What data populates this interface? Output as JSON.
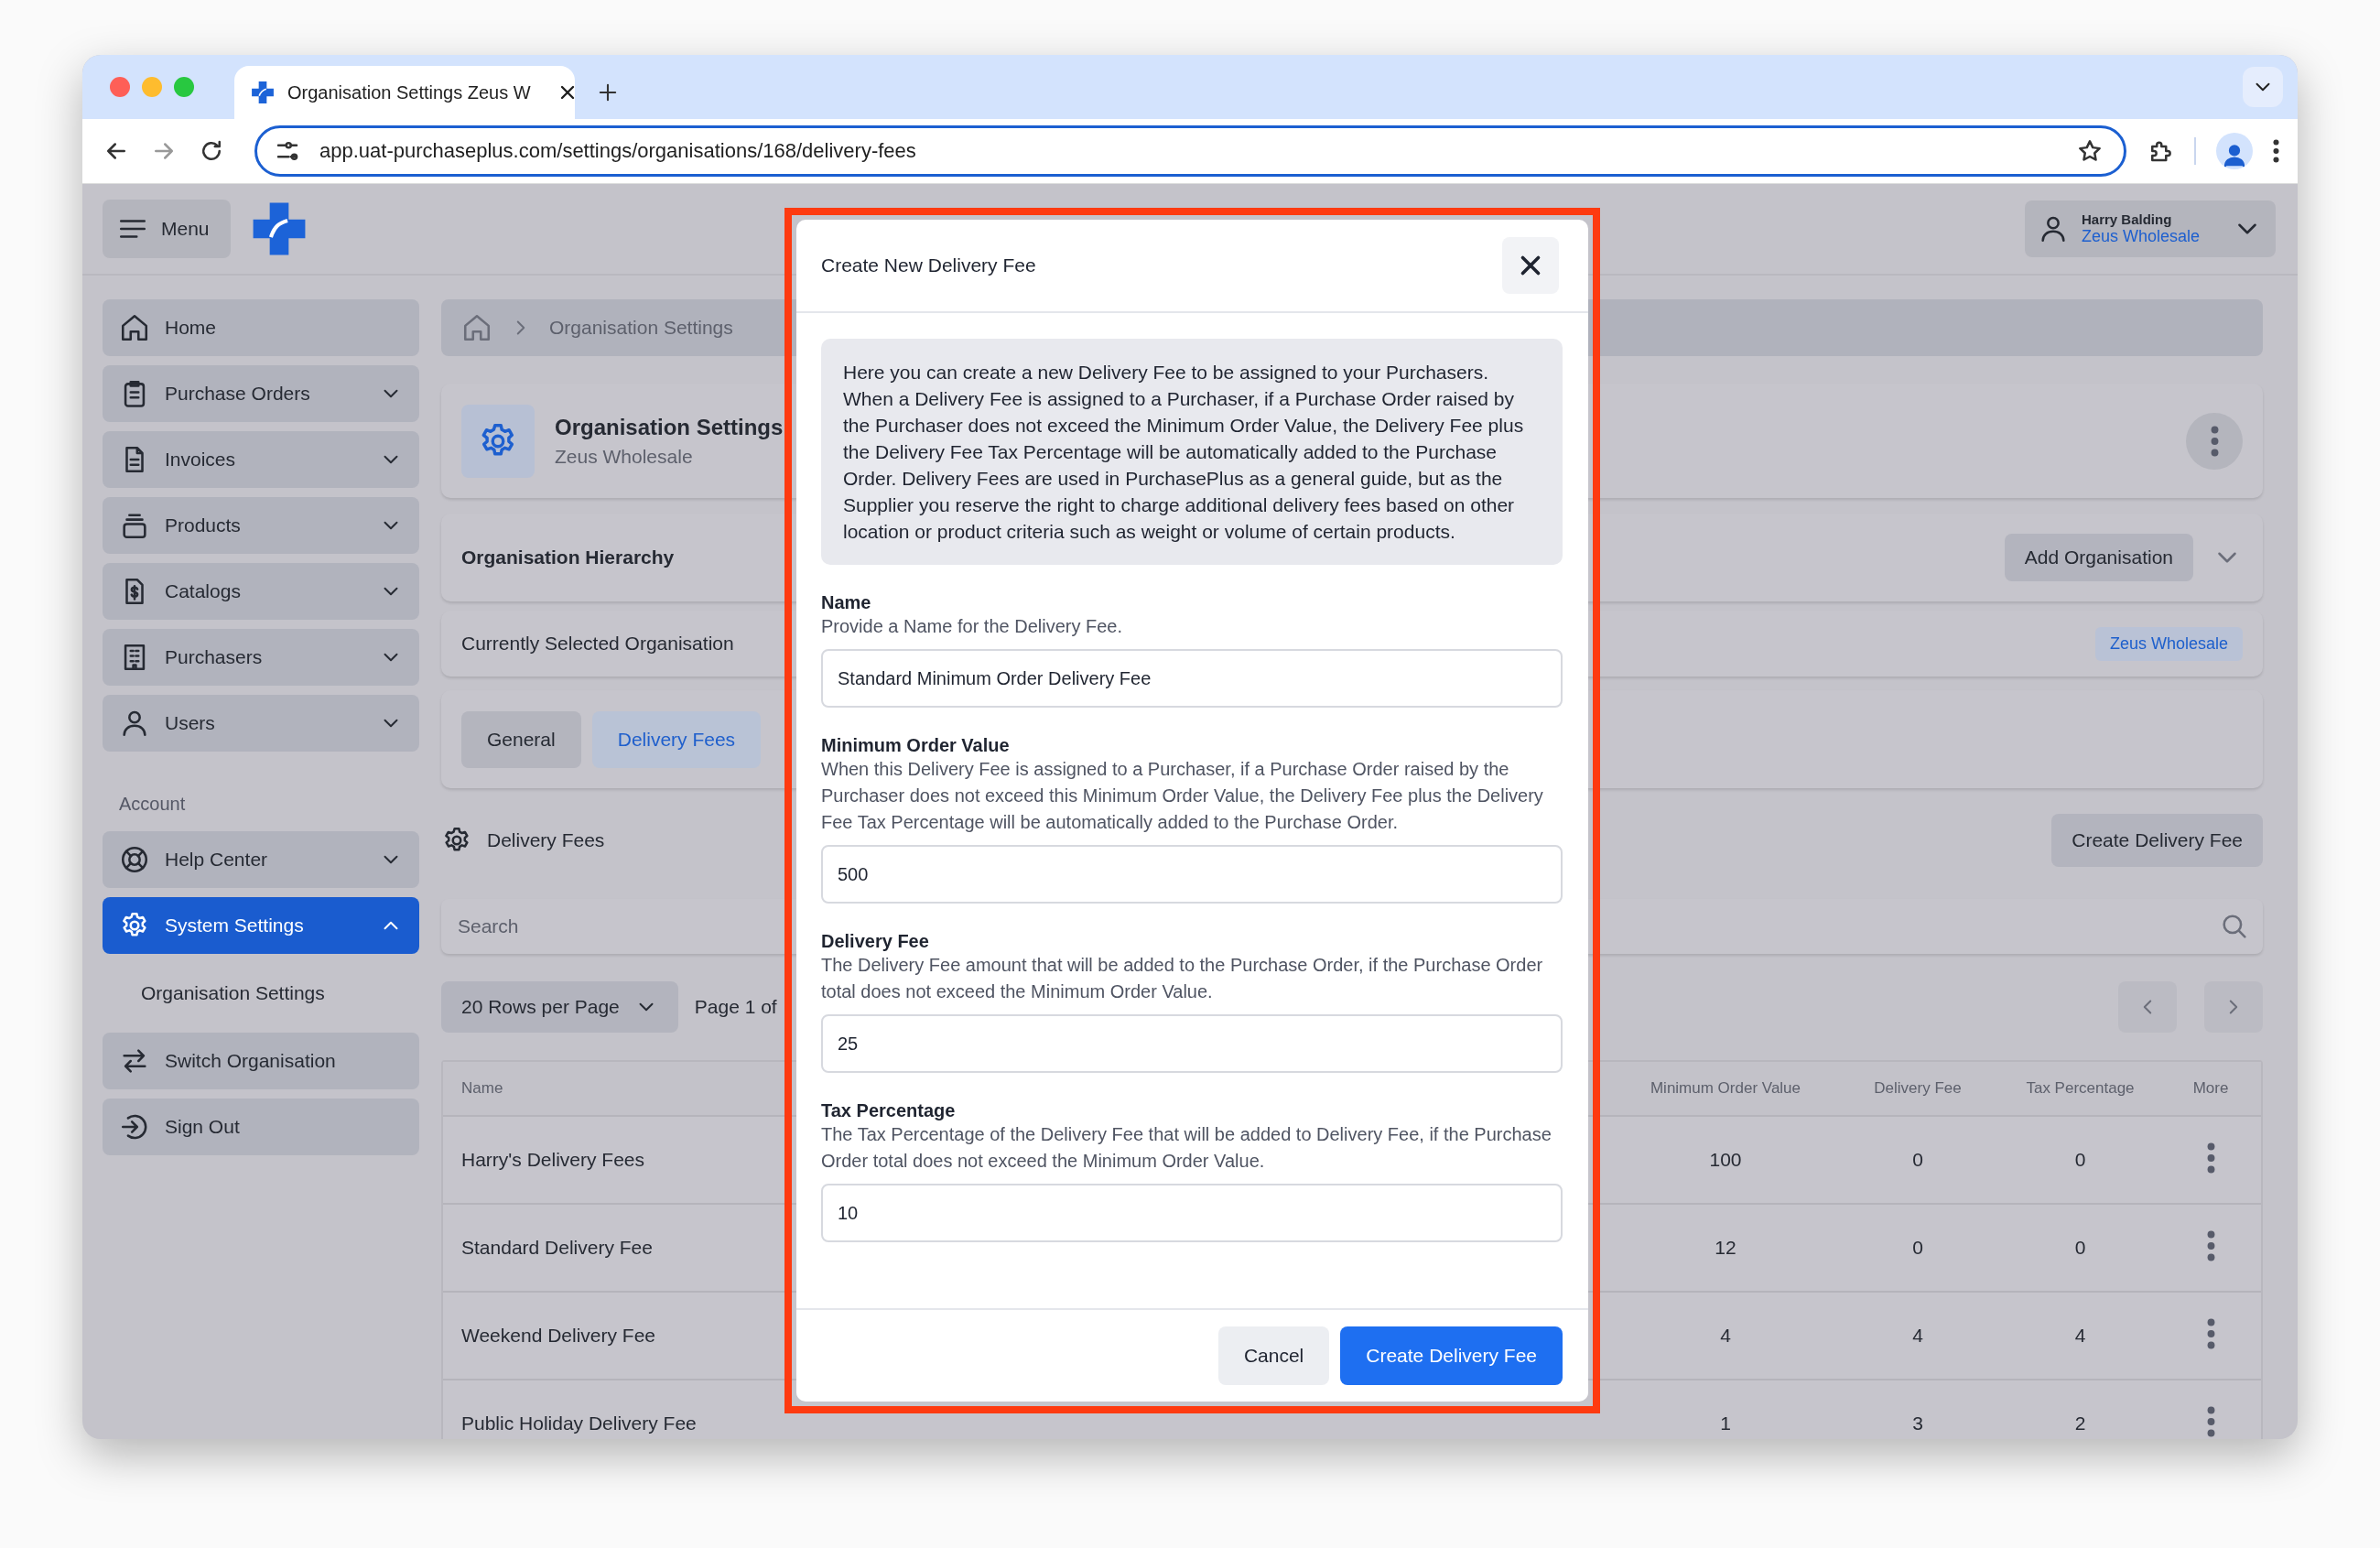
{
  "browser": {
    "tab_title": "Organisation Settings Zeus W",
    "url": "app.uat-purchaseplus.com/settings/organisations/168/delivery-fees"
  },
  "header": {
    "menu_label": "Menu",
    "user": {
      "name": "Harry Balding",
      "organisation": "Zeus Wholesale"
    }
  },
  "sidebar": {
    "items": [
      {
        "label": "Home",
        "kind": "link",
        "selected": false
      },
      {
        "label": "Purchase Orders",
        "kind": "group",
        "expanded": false,
        "selected": false
      },
      {
        "label": "Invoices",
        "kind": "group",
        "expanded": false,
        "selected": false
      },
      {
        "label": "Products",
        "kind": "group",
        "expanded": false,
        "selected": false
      },
      {
        "label": "Catalogs",
        "kind": "group",
        "expanded": false,
        "selected": false
      },
      {
        "label": "Purchasers",
        "kind": "group",
        "expanded": false,
        "selected": false
      },
      {
        "label": "Users",
        "kind": "group",
        "expanded": false,
        "selected": false
      }
    ],
    "account_label": "Account",
    "account_items": [
      {
        "label": "Help Center",
        "kind": "group",
        "expanded": false,
        "selected": false
      },
      {
        "label": "System Settings",
        "kind": "group",
        "expanded": true,
        "selected": true,
        "children": [
          {
            "label": "Organisation Settings"
          }
        ]
      },
      {
        "label": "Switch Organisation",
        "kind": "link",
        "selected": false
      },
      {
        "label": "Sign Out",
        "kind": "link",
        "selected": false
      }
    ]
  },
  "breadcrumb": [
    "Organisation Settings"
  ],
  "org_card": {
    "title": "Organisation Settings",
    "subtitle": "Zeus Wholesale"
  },
  "hierarchy": {
    "title": "Organisation Hierarchy",
    "button": "Add Organisation"
  },
  "selected_org": {
    "label": "Currently Selected Organisation",
    "badge": "Zeus Wholesale"
  },
  "tabs": [
    {
      "label": "General",
      "selected": false
    },
    {
      "label": "Delivery Fees",
      "selected": true
    }
  ],
  "section": {
    "title": "Delivery Fees",
    "button": "Create Delivery Fee"
  },
  "search": {
    "placeholder": "Search"
  },
  "pagination": {
    "rows_per_page": "20 Rows per Page",
    "page_info": "Page 1 of"
  },
  "table": {
    "columns": [
      "Name",
      "Minimum Order Value",
      "Delivery Fee",
      "Tax Percentage",
      "More"
    ],
    "rows": [
      {
        "name": "Harry's Delivery Fees",
        "min_order": "100",
        "fee": "0",
        "tax": "0"
      },
      {
        "name": "Standard Delivery Fee",
        "min_order": "12",
        "fee": "0",
        "tax": "0"
      },
      {
        "name": "Weekend Delivery Fee",
        "min_order": "4",
        "fee": "4",
        "tax": "4"
      },
      {
        "name": "Public Holiday Delivery Fee",
        "min_order": "1",
        "fee": "3",
        "tax": "2"
      }
    ]
  },
  "modal": {
    "title": "Create New Delivery Fee",
    "info": "Here you can create a new Delivery Fee to be assigned to your Purchasers. When a Delivery Fee is assigned to a Purchaser, if a Purchase Order raised by the Purchaser does not exceed the Minimum Order Value, the Delivery Fee plus the Delivery Fee Tax Percentage will be automatically added to the Purchase Order. Delivery Fees are used in PurchasePlus as a general guide, but as the Supplier you reserve the right to charge additional delivery fees based on other location or product criteria such as weight or volume of certain products.",
    "fields": [
      {
        "label": "Name",
        "hint": "Provide a Name for the Delivery Fee.",
        "value": "Standard Minimum Order Delivery Fee"
      },
      {
        "label": "Minimum Order Value",
        "hint": "When this Delivery Fee is assigned to a Purchaser, if a Purchase Order raised by the Purchaser does not exceed this Minimum Order Value, the Delivery Fee plus the Delivery Fee Tax Percentage will be automatically added to the Purchase Order.",
        "value": "500"
      },
      {
        "label": "Delivery Fee",
        "hint": "The Delivery Fee amount that will be added to the Purchase Order, if the Purchase Order total does not exceed the Minimum Order Value.",
        "value": "25"
      },
      {
        "label": "Tax Percentage",
        "hint": "The Tax Percentage of the Delivery Fee that will be added to Delivery Fee, if the Purchase Order total does not exceed the Minimum Order Value.",
        "value": "10"
      }
    ],
    "buttons": [
      {
        "label": "Cancel",
        "kind": "secondary"
      },
      {
        "label": "Create Delivery Fee",
        "kind": "primary"
      }
    ]
  }
}
